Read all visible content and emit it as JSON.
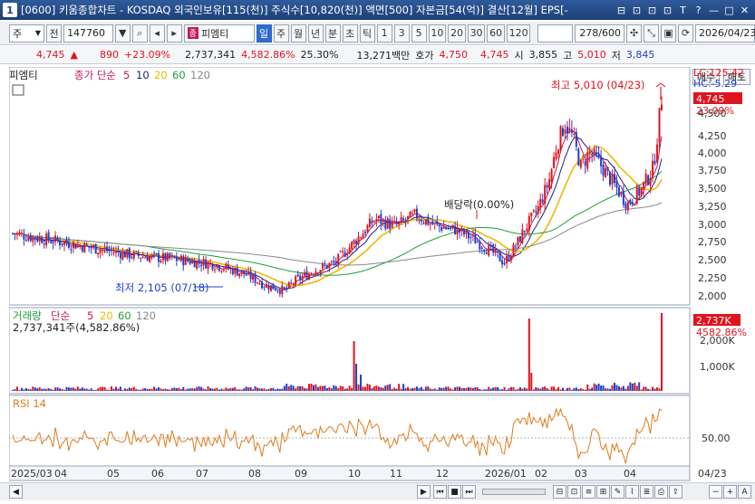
{
  "window": {
    "badge": "1",
    "title": "[0600] 키움종합차트 - KOSDAQ 외국인보유[115(천)] 주식수[10,820(천)] 액면[500] 자본금[54(억)] 결산[12월] EPS[-",
    "icons": [
      "⊟",
      "⊡",
      "⊡",
      "⊡",
      "T",
      "?",
      "—",
      "□",
      "✕"
    ]
  },
  "toolbar": {
    "type_label": "주",
    "prev_label": "전",
    "code": "147760",
    "indicator_tag": "종",
    "indicator_name": "피엠티",
    "periods": [
      "일",
      "주",
      "월",
      "년",
      "분",
      "초",
      "틱"
    ],
    "selected_period": "일",
    "intervals": [
      "1",
      "3",
      "5",
      "10",
      "20",
      "30",
      "60",
      "120"
    ],
    "count_display": "278/600",
    "date": "2026/04/23"
  },
  "pricebar": {
    "price": "4,745",
    "change": "890",
    "rate": "+23.09%",
    "volume": "2,737,341",
    "volume_rate": "4,582.86%",
    "turnover": "25.30%",
    "amount": "13,271백만",
    "quote_label": "호가",
    "ask": "4,750",
    "bid": "4,745",
    "open_label": "시",
    "open": "3,855",
    "high_label": "고",
    "high": "5,010",
    "low_label": "저",
    "low": "3,845"
  },
  "trade_buttons": {
    "buy": "매수",
    "sell": "매도"
  },
  "price_panel": {
    "name": "피엠티",
    "ma_title": "종가 단순",
    "ma_periods": [
      "5",
      "10",
      "20",
      "60",
      "120"
    ],
    "ma_colors": [
      "#c2185b",
      "#1a237e",
      "#f2b705",
      "#1e9e3a",
      "#888888"
    ],
    "lc_label": "LC:125.42",
    "hc_label": "HC:-5.29",
    "current_price": "4,745",
    "current_rate": "23.09%",
    "y_ticks": [
      "4,500",
      "4,250",
      "4,000",
      "3,750",
      "3,500",
      "3,250",
      "3,000",
      "2,750",
      "2,500",
      "2,250",
      "2,000"
    ],
    "annot_high": "최고 5,010 (04/23)",
    "annot_low": "최저 2,105 (07/18)",
    "annot_dividend": "배당락(0.00%)"
  },
  "volume_panel": {
    "title": "거래량",
    "ma_title": "단순",
    "ma_periods": [
      "5",
      "20",
      "60",
      "120"
    ],
    "value_text": "2,737,341주(4,582.86%)",
    "current_label": "2,737K",
    "current_rate": "4582.86%",
    "y_ticks": [
      "2,000K",
      "1,000K"
    ]
  },
  "rsi_panel": {
    "title": "RSI 14",
    "y_ticks": [
      "50.00"
    ]
  },
  "x_axis": {
    "labels": [
      "2025/03",
      "04",
      "05",
      "06",
      "07",
      "08",
      "09",
      "10",
      "11",
      "12",
      "2026/01",
      "02",
      "03",
      "04"
    ],
    "right_label": "04/23"
  },
  "colors": {
    "up": "#e0141e",
    "down": "#1f3fd0",
    "rsi": "#e07b1a"
  }
}
